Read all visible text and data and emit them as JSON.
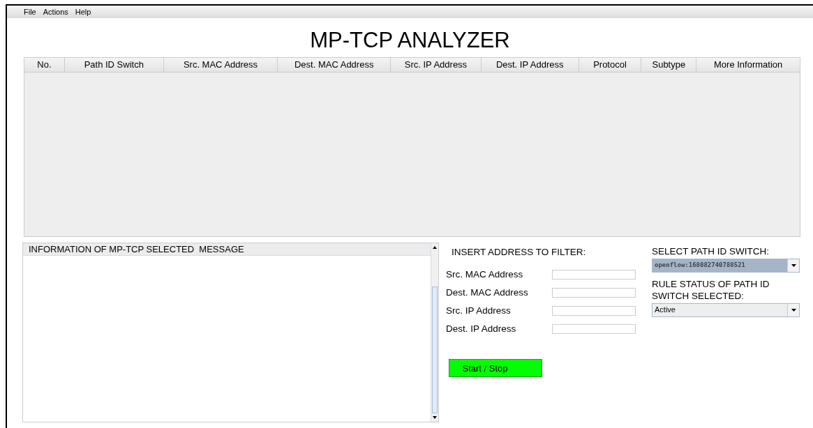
{
  "menu": [
    "File",
    "Actions",
    "Help"
  ],
  "title": "MP-TCP ANALYZER",
  "table": {
    "columns": [
      "No.",
      "Path ID Switch",
      "Src. MAC Address",
      "Dest. MAC Address",
      "Src. IP Address",
      "Dest. IP Address",
      "Protocol",
      "Subtype",
      "More Information"
    ]
  },
  "info_panel": {
    "title": "INFORMATION OF MP-TCP SELECTED  MESSAGE"
  },
  "filter": {
    "title": "INSERT ADDRESS TO FILTER:",
    "fields": [
      {
        "label": "Src. MAC Address"
      },
      {
        "label": "Dest. MAC Address"
      },
      {
        "label": "Src. IP Address"
      },
      {
        "label": "Dest. IP Address"
      }
    ],
    "button": "Start / Stop"
  },
  "switch_select": {
    "label": "SELECT PATH ID SWITCH:",
    "value": "openflow:168082740788521"
  },
  "rule_status": {
    "label": "RULE STATUS OF PATH ID SWITCH SELECTED:",
    "value": "Active"
  }
}
